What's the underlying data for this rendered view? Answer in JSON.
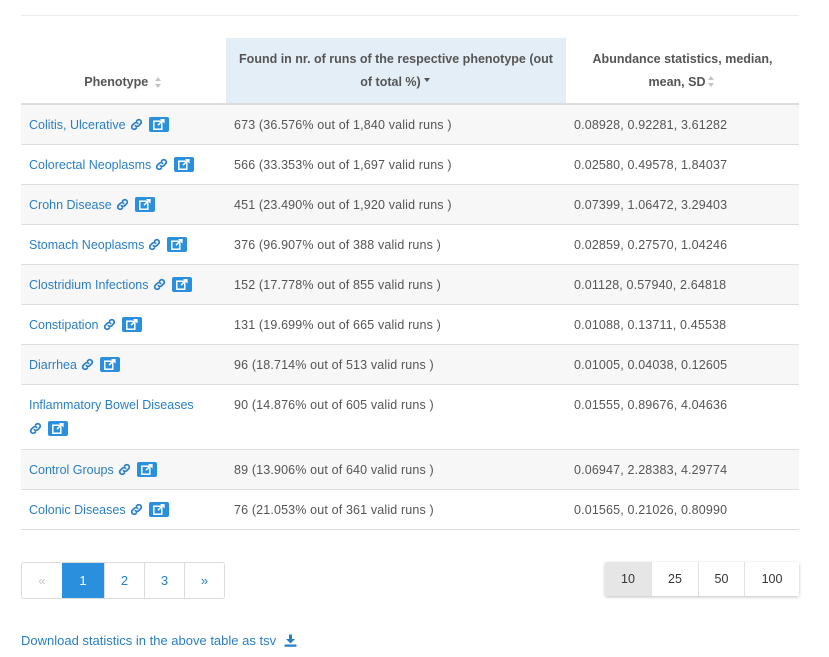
{
  "table": {
    "headers": {
      "phenotype": "Phenotype",
      "found": "Found in nr. of runs of the respective phenotype (out of total %)",
      "abundance": "Abundance statistics, median, mean, SD"
    },
    "rows": [
      {
        "phenotype": "Colitis, Ulcerative",
        "found": "673 (36.576% out of 1,840 valid runs )",
        "abundance": "0.08928, 0.92281, 3.61282"
      },
      {
        "phenotype": "Colorectal Neoplasms",
        "found": "566 (33.353% out of 1,697 valid runs )",
        "abundance": "0.02580, 0.49578, 1.84037"
      },
      {
        "phenotype": "Crohn Disease",
        "found": "451 (23.490% out of 1,920 valid runs )",
        "abundance": "0.07399, 1.06472, 3.29403"
      },
      {
        "phenotype": "Stomach Neoplasms",
        "found": "376 (96.907% out of 388 valid runs )",
        "abundance": "0.02859, 0.27570, 1.04246"
      },
      {
        "phenotype": "Clostridium Infections",
        "found": "152 (17.778% out of 855 valid runs )",
        "abundance": "0.01128, 0.57940, 2.64818"
      },
      {
        "phenotype": "Constipation",
        "found": "131 (19.699% out of 665 valid runs )",
        "abundance": "0.01088, 0.13711, 0.45538"
      },
      {
        "phenotype": "Diarrhea",
        "found": "96 (18.714% out of 513 valid runs )",
        "abundance": "0.01005, 0.04038, 0.12605"
      },
      {
        "phenotype": "Inflammatory Bowel Diseases",
        "found": "90 (14.876% out of 605 valid runs )",
        "abundance": "0.01555, 0.89676, 4.04636"
      },
      {
        "phenotype": "Control Groups",
        "found": "89 (13.906% out of 640 valid runs )",
        "abundance": "0.06947, 2.28383, 4.29774"
      },
      {
        "phenotype": "Colonic Diseases",
        "found": "76 (21.053% out of 361 valid runs )",
        "abundance": "0.01565, 0.21026, 0.80990"
      }
    ]
  },
  "pagination": {
    "prev": "«",
    "pages": [
      "1",
      "2",
      "3"
    ],
    "next": "»",
    "current": "1"
  },
  "page_size": {
    "options": [
      "10",
      "25",
      "50",
      "100"
    ],
    "selected": "10"
  },
  "download": {
    "label": "Download statistics in the above table as tsv"
  },
  "colors": {
    "link": "#2a7fc4",
    "accent": "#2a8fdc",
    "sorted_header_bg": "#e4eef6"
  },
  "icons": {
    "row_link": "link-icon",
    "row_external": "external-link-icon",
    "download": "download-icon"
  }
}
